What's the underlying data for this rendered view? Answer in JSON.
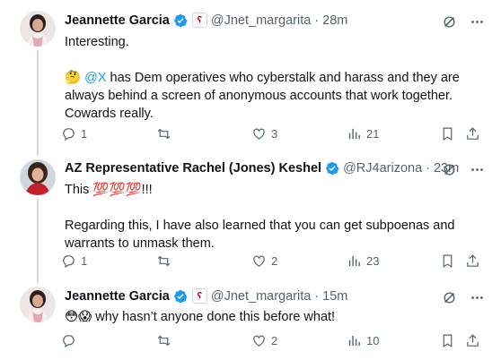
{
  "tweets": [
    {
      "name": "Jeannette Garcia",
      "handle": "@Jnet_margarita",
      "dot": "·",
      "time": "28m",
      "text_line1": "Interesting.",
      "emoji": "🤔",
      "mention": "@X",
      "text_line2": " has Dem operatives who cyberstalk and harass and they are always behind a screen of anonymous accounts that work together. Cowards really.",
      "replies": "1",
      "reposts": "",
      "likes": "3",
      "views": "21"
    },
    {
      "name": "AZ Representative Rachel (Jones) Keshel",
      "handle": "@RJ4arizona",
      "dot": "·",
      "time": "23m",
      "text_line1": "This ",
      "emoji_100": "💯💯💯",
      "text_line1b": "!!!",
      "text_line2": "Regarding this, I have also learned that you can get subpoenas and warrants to unmask them.",
      "replies": "1",
      "reposts": "",
      "likes": "2",
      "views": "23"
    },
    {
      "name": "Jeannette Garcia",
      "handle": "@Jnet_margarita",
      "dot": "·",
      "time": "15m",
      "emoji": "😳😱",
      "text_line1": " why hasn’t anyone done this before what!",
      "replies": "",
      "reposts": "",
      "likes": "2",
      "views": "10"
    }
  ],
  "colors": {
    "verified": "#1d9bf0",
    "mention": "#1d9bf0",
    "muted": "#536471",
    "line": "#cfd9de"
  },
  "icons": [
    "reply-icon",
    "repost-icon",
    "like-icon",
    "views-icon",
    "bookmark-icon",
    "share-icon",
    "grok-icon",
    "more-icon",
    "verified-icon"
  ]
}
